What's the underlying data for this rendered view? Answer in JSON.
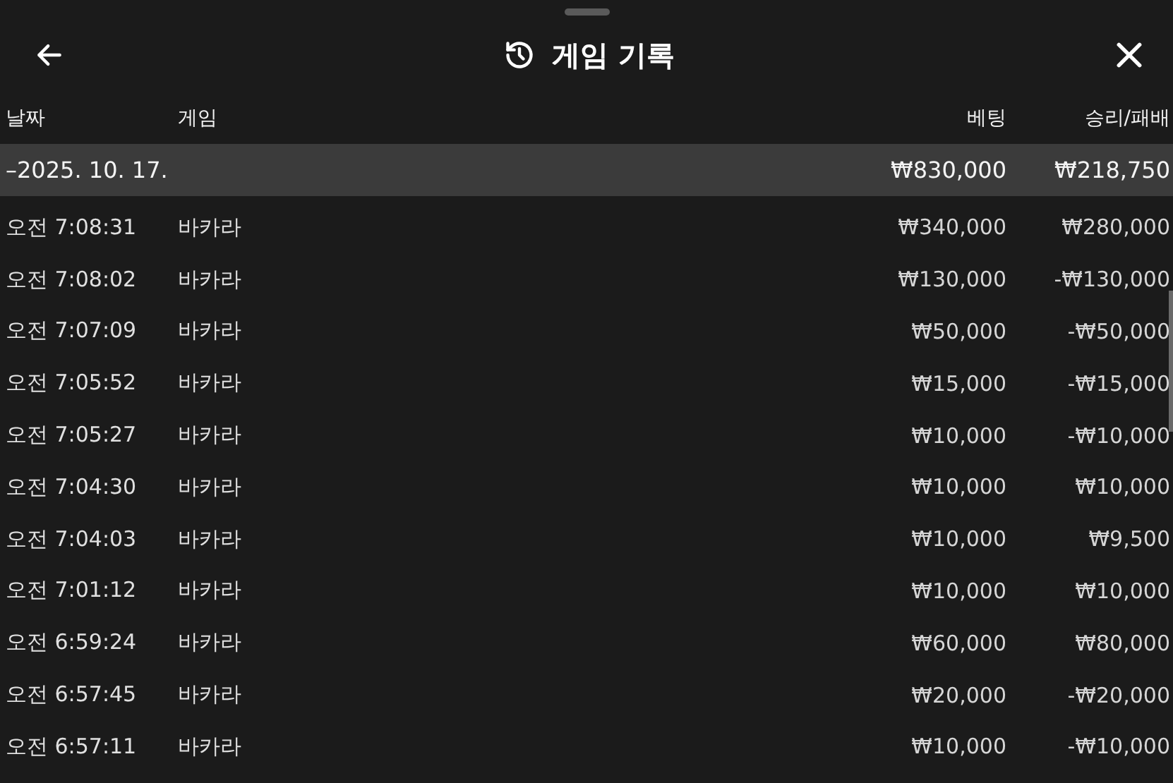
{
  "header": {
    "title": "게임 기록"
  },
  "table": {
    "columns": [
      "날짜",
      "게임",
      "베팅",
      "승리/패배"
    ],
    "groups": [
      {
        "date": "–2025. 10. 17.",
        "bet": "₩830,000",
        "result": "₩218,750",
        "expanded": true,
        "rows": [
          {
            "time": "오전 7:08:31",
            "game": "바카라",
            "bet": "₩340,000",
            "result": "₩280,000"
          },
          {
            "time": "오전 7:08:02",
            "game": "바카라",
            "bet": "₩130,000",
            "result": "-₩130,000"
          },
          {
            "time": "오전 7:07:09",
            "game": "바카라",
            "bet": "₩50,000",
            "result": "-₩50,000"
          },
          {
            "time": "오전 7:05:52",
            "game": "바카라",
            "bet": "₩15,000",
            "result": "-₩15,000"
          },
          {
            "time": "오전 7:05:27",
            "game": "바카라",
            "bet": "₩10,000",
            "result": "-₩10,000"
          },
          {
            "time": "오전 7:04:30",
            "game": "바카라",
            "bet": "₩10,000",
            "result": "₩10,000"
          },
          {
            "time": "오전 7:04:03",
            "game": "바카라",
            "bet": "₩10,000",
            "result": "₩9,500"
          },
          {
            "time": "오전 7:01:12",
            "game": "바카라",
            "bet": "₩10,000",
            "result": "₩10,000"
          },
          {
            "time": "오전 6:59:24",
            "game": "바카라",
            "bet": "₩60,000",
            "result": "₩80,000"
          },
          {
            "time": "오전 6:57:45",
            "game": "바카라",
            "bet": "₩20,000",
            "result": "-₩20,000"
          },
          {
            "time": "오전 6:57:11",
            "game": "바카라",
            "bet": "₩10,000",
            "result": "-₩10,000"
          }
        ]
      }
    ]
  }
}
